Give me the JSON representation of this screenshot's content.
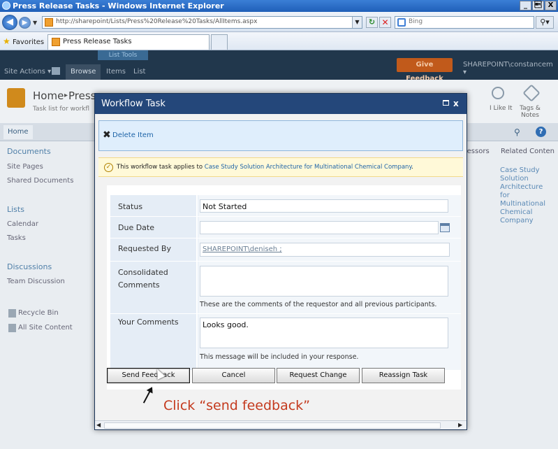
{
  "browser": {
    "window_title": "Press Release Tasks - Windows Internet Explorer",
    "window_buttons": [
      "_",
      "\u0019",
      "X"
    ],
    "url": "http://sharepoint/Lists/Press%20Release%20Tasks/AllItems.aspx",
    "search_placeholder": "Bing",
    "favorites_label": "Favorites",
    "tab_title": "Press Release Tasks"
  },
  "ribbon": {
    "list_tools": "List Tools",
    "site_actions": "Site Actions ▾",
    "tabs": [
      "Browse",
      "Items",
      "List"
    ],
    "give_feedback": "Give Feedback",
    "user": "SHAREPOINT\\constancem ▾"
  },
  "header": {
    "crumb_home": "Home",
    "crumb_sep": "▸",
    "crumb_press": "Press",
    "description": "Task list for workfl",
    "like_label": "I Like It",
    "tags_label": "Tags & Notes"
  },
  "topbar": {
    "home_tab": "Home"
  },
  "quicklaunch": {
    "documents": "Documents",
    "site_pages": "Site Pages",
    "shared_documents": "Shared Documents",
    "lists": "Lists",
    "calendar": "Calendar",
    "tasks": "Tasks",
    "discussions": "Discussions",
    "team_discussion": "Team Discussion",
    "recycle_bin": "Recycle Bin",
    "all_site_content": "All Site Content"
  },
  "right_col": {
    "col1": "ecessors",
    "col2": "Related Conten",
    "related_link": "Case Study Solution Architecture for Multinational Chemical Company"
  },
  "modal": {
    "title": "Workflow Task",
    "close_glyph": "x",
    "delete_item": "Delete Item",
    "notice_prefix": "This workflow task applies to ",
    "notice_link": "Case Study Solution Architecture for Multinational Chemical Company",
    "notice_suffix": ".",
    "fields": {
      "status_label": "Status",
      "status_value": "Not Started",
      "due_date_label": "Due Date",
      "due_date_value": "",
      "requested_by_label": "Requested By",
      "requested_by_value": "SHAREPOINT\\deniseh ;",
      "consolidated_label": "Consolidated Comments",
      "consolidated_value": "",
      "consolidated_hint": "These are the comments of the requestor and all previous participants.",
      "your_comments_label": "Your Comments",
      "your_comments_value": "Looks good.",
      "your_comments_hint": "This message will be included in your response."
    },
    "buttons": {
      "send_feedback": "Send Feedback",
      "cancel": "Cancel",
      "request_change": "Request Change",
      "reassign_task": "Reassign Task"
    },
    "annotation": "Click “send feedback”"
  }
}
